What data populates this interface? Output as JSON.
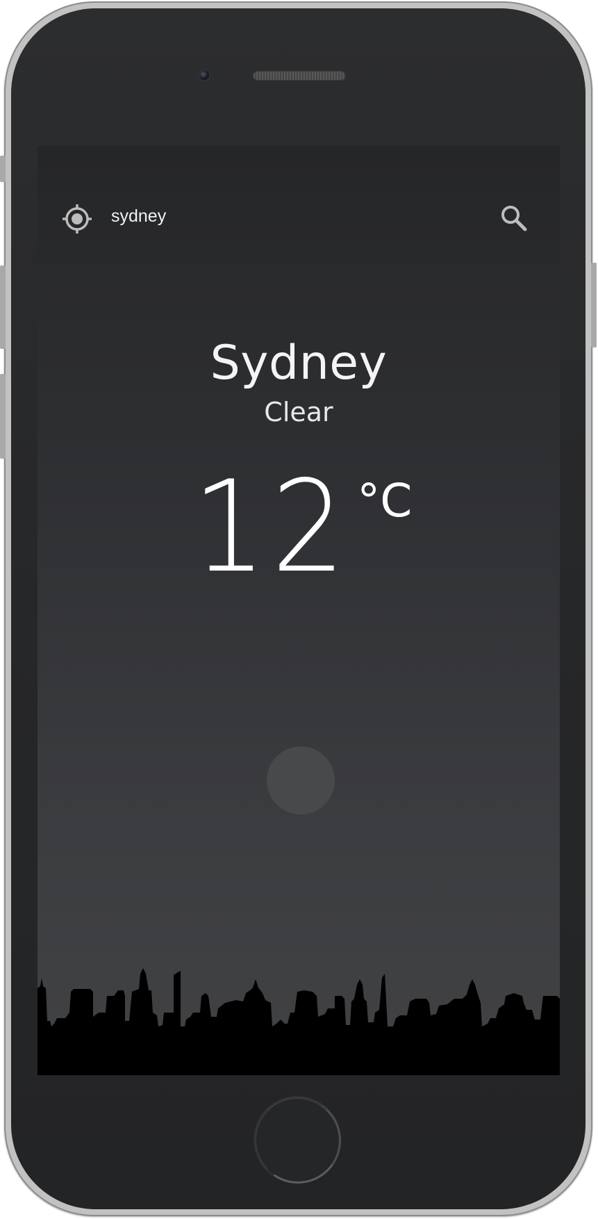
{
  "device": {
    "name": "phone",
    "icons": {
      "camera": "front-camera-icon",
      "speaker": "earpiece-speaker-icon",
      "home": "home-button-icon"
    }
  },
  "app": {
    "top_bar": {
      "search_query": "sydney",
      "locate_icon": "crosshair-locate-icon",
      "search_icon": "magnifier-search-icon"
    },
    "weather": {
      "city": "Sydney",
      "condition": "Clear",
      "temperature": "12",
      "unit": "°C"
    },
    "colors": {
      "screen_top": "#252628",
      "screen_bottom": "#414244",
      "text": "#ffffff",
      "icon": "#bdbdbd",
      "skyline": "#000000",
      "loader": "#48494b"
    }
  }
}
